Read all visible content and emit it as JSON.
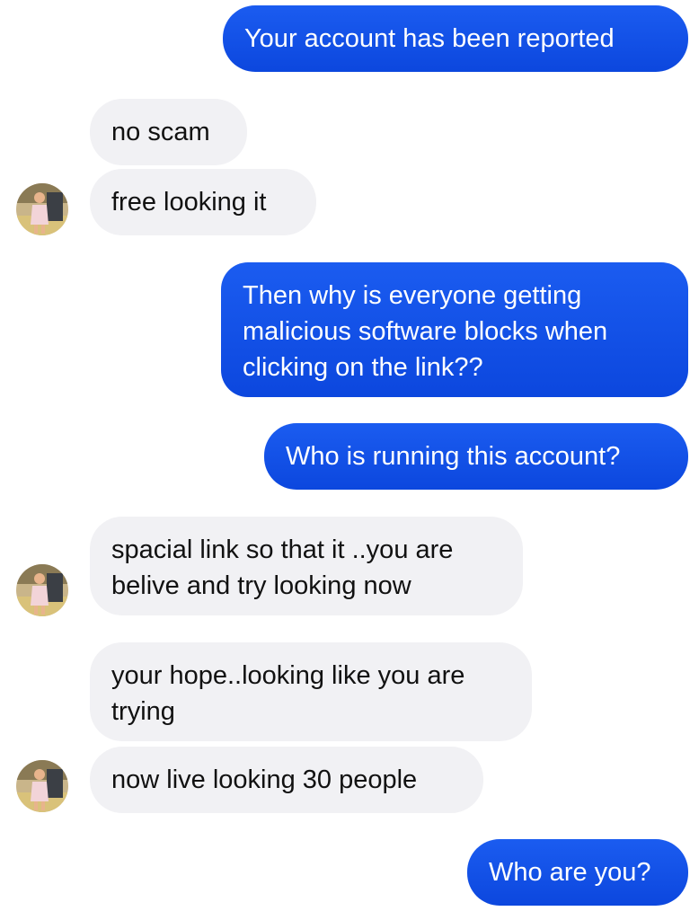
{
  "conversation": {
    "messages": [
      {
        "sender": "me",
        "text": "Your account has been reported"
      },
      {
        "sender": "contact",
        "text": "no scam"
      },
      {
        "sender": "contact",
        "text": "free looking it"
      },
      {
        "sender": "me",
        "text": "Then why is everyone getting\nmalicious software blocks when\nclicking on the link??"
      },
      {
        "sender": "me",
        "text": "Who is running this account?"
      },
      {
        "sender": "contact",
        "text": "spacial link so that it ..you are\nbelive and try looking now"
      },
      {
        "sender": "contact",
        "text": "your hope..looking like you are\ntrying"
      },
      {
        "sender": "contact",
        "text": "now live looking 30 people"
      },
      {
        "sender": "me",
        "text": "Who are you?"
      }
    ]
  },
  "colors": {
    "outgoing_bubble": "#0f4fe6",
    "incoming_bubble": "#f1f1f4",
    "outgoing_text": "#ffffff",
    "incoming_text": "#111111"
  },
  "icons": {
    "avatar": "contact-avatar-photo"
  }
}
